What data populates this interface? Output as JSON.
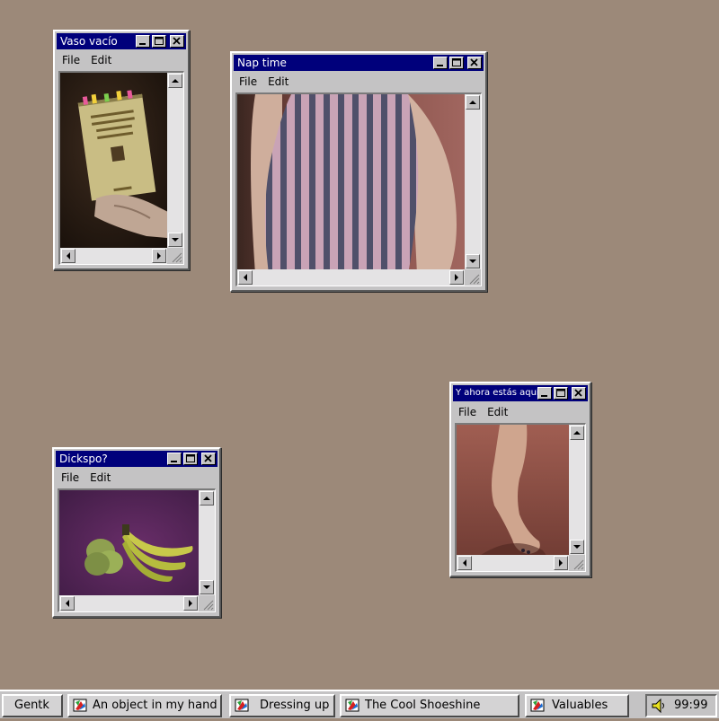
{
  "windows": [
    {
      "id": "vaso",
      "title": "Vaso vacío",
      "menu": [
        "File",
        "Edit"
      ],
      "image": "photo of hand holding a book"
    },
    {
      "id": "nap",
      "title": "Nap time",
      "menu": [
        "File",
        "Edit"
      ],
      "image": "photo of striped top"
    },
    {
      "id": "ahora",
      "title": "Y ahora estás aquí",
      "menu": [
        "File",
        "Edit"
      ],
      "image": "photo of a foot on tiptoe"
    },
    {
      "id": "dickspo",
      "title": "Dickspo?",
      "menu": [
        "File",
        "Edit"
      ],
      "image": "photo of bananas and pears"
    }
  ],
  "taskbar": {
    "start_label": "Gentk",
    "buttons": [
      "An object in my hand",
      "Dressing up",
      "The Cool Shoeshine",
      "Valuables"
    ],
    "clock": "99:99",
    "tray_icon": "speaker-icon"
  },
  "colors": {
    "desktop": "#9c8979",
    "titlebar": "#00007b",
    "chrome": "#c4c3c4"
  }
}
